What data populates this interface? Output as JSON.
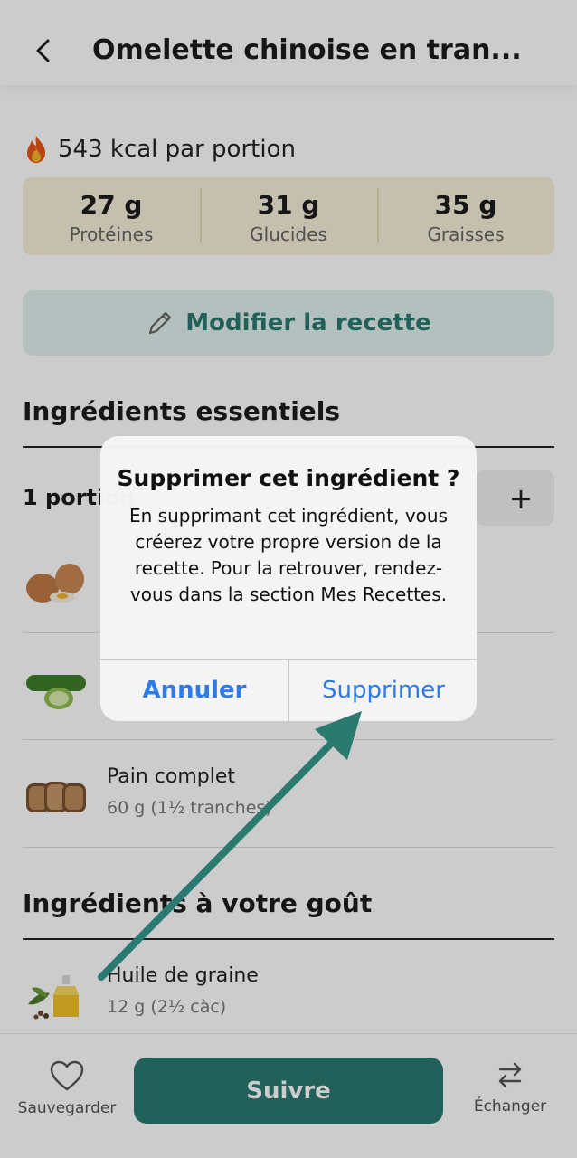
{
  "header": {
    "title": "Omelette chinoise en tran...",
    "title_peek": "tranches"
  },
  "summary": {
    "kcal_text": "543 kcal par portion",
    "macros": [
      {
        "value": "27 g",
        "label": "Protéines"
      },
      {
        "value": "31 g",
        "label": "Glucides"
      },
      {
        "value": "35 g",
        "label": "Graisses"
      }
    ]
  },
  "modify_button": {
    "label": "Modifier la recette"
  },
  "essentials": {
    "title": "Ingrédients essentiels",
    "portions": "1 portion",
    "stepper_plus": "+",
    "items": [
      {
        "name": "",
        "qty": "",
        "icon": "eggs"
      },
      {
        "name": "",
        "qty": "",
        "icon": "cucumber"
      },
      {
        "name": "Pain complet",
        "qty": "60 g (1½ tranches)",
        "icon": "bread"
      }
    ]
  },
  "to_taste": {
    "title": "Ingrédients à votre goût",
    "items": [
      {
        "name": "Huile de graine",
        "qty": "12 g (2½ càc)",
        "icon": "seed-oil"
      }
    ]
  },
  "bottom_bar": {
    "save_label": "Sauvegarder",
    "follow_label": "Suivre",
    "swap_label": "Échanger"
  },
  "dialog": {
    "title": "Supprimer cet ingrédient ?",
    "message": "En supprimant cet ingrédient, vous créerez votre propre version de la recette. Pour la retrouver, rendez-vous dans la section Mes Recettes.",
    "cancel_label": "Annuler",
    "confirm_label": "Supprimer"
  },
  "colors": {
    "accent": "#2b7a70",
    "macro_bg": "#f7efd9",
    "modify_bg": "#e0f0ee",
    "ios_blue": "#2f7be5",
    "arrow": "#2b7a70"
  }
}
